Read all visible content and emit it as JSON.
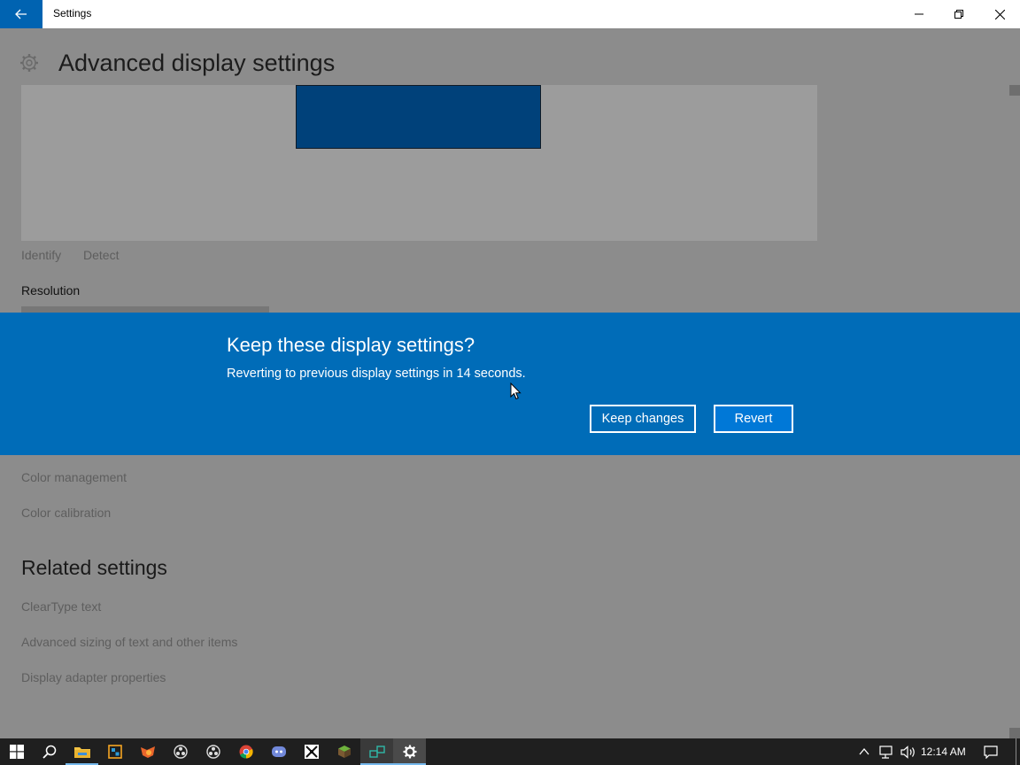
{
  "window": {
    "title": "Settings"
  },
  "page": {
    "title": "Advanced display settings",
    "identify": "Identify",
    "detect": "Detect",
    "resolution_label": "Resolution",
    "color_management": "Color management",
    "color_calibration": "Color calibration",
    "related_settings": "Related settings",
    "cleartype": "ClearType text",
    "advanced_sizing": "Advanced sizing of text and other items",
    "adapter_properties": "Display adapter properties"
  },
  "dialog": {
    "title": "Keep these display settings?",
    "message": "Reverting to previous display settings in 14 seconds.",
    "keep_label": "Keep changes",
    "revert_label": "Revert"
  },
  "taskbar": {
    "apps": [
      "start-icon",
      "search-icon",
      "file-explorer-icon",
      "store-icon",
      "firefox-icon",
      "obs-icon",
      "obs-icon-2",
      "chrome-icon",
      "discord-icon",
      "app-icon",
      "minecraft-icon",
      "network-app-icon",
      "settings-icon"
    ],
    "clock": "12:14 AM"
  },
  "colors": {
    "accent": "#0078d7",
    "banner": "#006cb8",
    "overlay": "#8c8c8c"
  }
}
